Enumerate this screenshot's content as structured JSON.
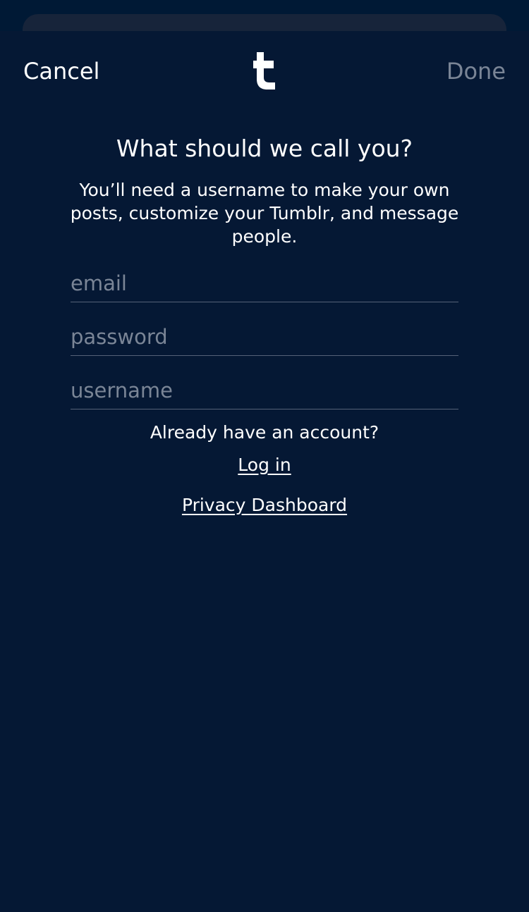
{
  "header": {
    "cancel_label": "Cancel",
    "done_label": "Done",
    "logo_icon": "tumblr-logo-icon"
  },
  "main": {
    "title": "What should we call you?",
    "subtitle": "You’ll need a username to make your own posts, customize your Tumblr, and message people."
  },
  "form": {
    "email_placeholder": "email",
    "password_placeholder": "password",
    "username_placeholder": "username"
  },
  "footer": {
    "account_question": "Already have an account?",
    "login_link": "Log in",
    "privacy_link": "Privacy Dashboard"
  },
  "colors": {
    "background": "#051834",
    "text": "#ffffff",
    "muted": "#7a8596",
    "divider": "#556278"
  }
}
